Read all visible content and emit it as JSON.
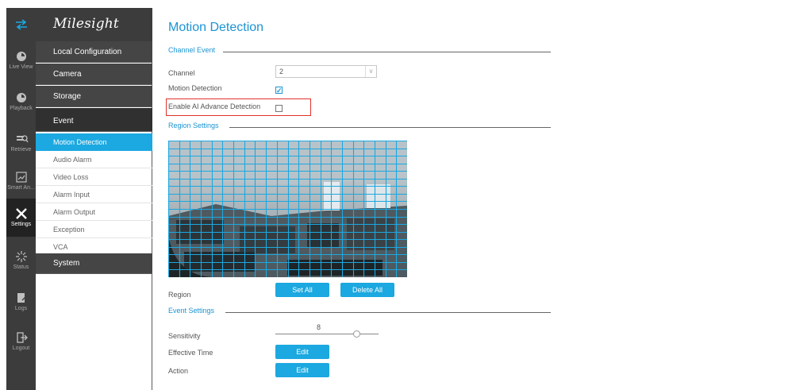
{
  "rail": {
    "items": [
      {
        "label": "",
        "icon": "swap-arrows-icon"
      },
      {
        "label": "Live View",
        "icon": "live-view-icon"
      },
      {
        "label": "Playback",
        "icon": "playback-icon"
      },
      {
        "label": "Retrieve",
        "icon": "retrieve-icon"
      },
      {
        "label": "Smart An...",
        "icon": "smart-analysis-icon"
      },
      {
        "label": "Settings",
        "icon": "settings-icon"
      },
      {
        "label": "Status",
        "icon": "status-icon"
      },
      {
        "label": "Logs",
        "icon": "logs-icon"
      },
      {
        "label": "Logout",
        "icon": "logout-icon"
      }
    ]
  },
  "brand": {
    "name": "Milesight"
  },
  "menu": {
    "groups": [
      "Local Configuration",
      "Camera",
      "Storage",
      "Event",
      "System"
    ],
    "event_items": [
      "Motion Detection",
      "Audio Alarm",
      "Video Loss",
      "Alarm Input",
      "Alarm Output",
      "Exception",
      "VCA"
    ],
    "active_item": "Motion Detection"
  },
  "page": {
    "title": "Motion Detection",
    "channel_event": {
      "heading": "Channel Event",
      "channel_label": "Channel",
      "channel_value": "2",
      "motion_label": "Motion Detection",
      "motion_checked": true,
      "ai_label": "Enable AI Advance Detection",
      "ai_checked": false
    },
    "region_settings": {
      "heading": "Region Settings",
      "region_label": "Region",
      "set_all": "Set All",
      "delete_all": "Delete All"
    },
    "event_settings": {
      "heading": "Event Settings",
      "sensitivity_label": "Sensitivity",
      "sensitivity_value": "8",
      "effective_time_label": "Effective Time",
      "effective_edit": "Edit",
      "action_label": "Action",
      "action_edit": "Edit"
    }
  },
  "colors": {
    "accent": "#1ca8e0",
    "title": "#1b94d2",
    "rail": "#3c3c3c",
    "highlight": "#e0322c"
  }
}
